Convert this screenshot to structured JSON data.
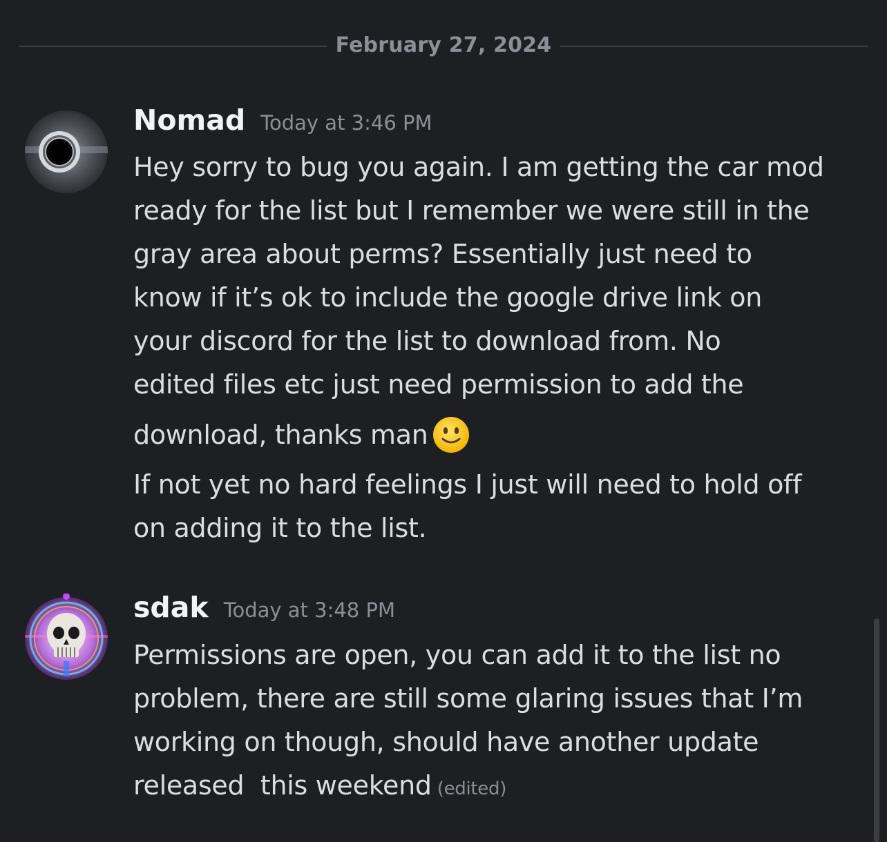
{
  "date_divider": "February 27, 2024",
  "messages": [
    {
      "username": "Nomad",
      "timestamp": "Today at 3:46 PM",
      "lines": [
        "Hey sorry to bug you again. I am getting the car mod",
        "ready for the list but I remember we were still in the",
        "gray area about perms? Essentially just need to",
        "know if it’s ok to include the google drive link on",
        "your discord for the list to download from. No",
        "edited files etc just need permission to add the",
        "download, thanks man",
        "If not yet no hard feelings I just will need to hold off",
        "on adding it to the list."
      ],
      "emoji": "slightly-smiling-face-icon"
    },
    {
      "username": "sdak",
      "timestamp": "Today at 3:48 PM",
      "lines": [
        "Permissions are open, you can add it to the list no",
        "problem, there are still some glaring issues that I’m",
        "working on though, should have another update",
        "released  this weekend"
      ],
      "edited_label": "(edited)"
    }
  ],
  "colors": {
    "background": "#1e1f23",
    "username": "#f2f3f5",
    "message_text": "#dbdee1",
    "muted": "#8c8f97",
    "divider_line": "#3a3c42"
  }
}
